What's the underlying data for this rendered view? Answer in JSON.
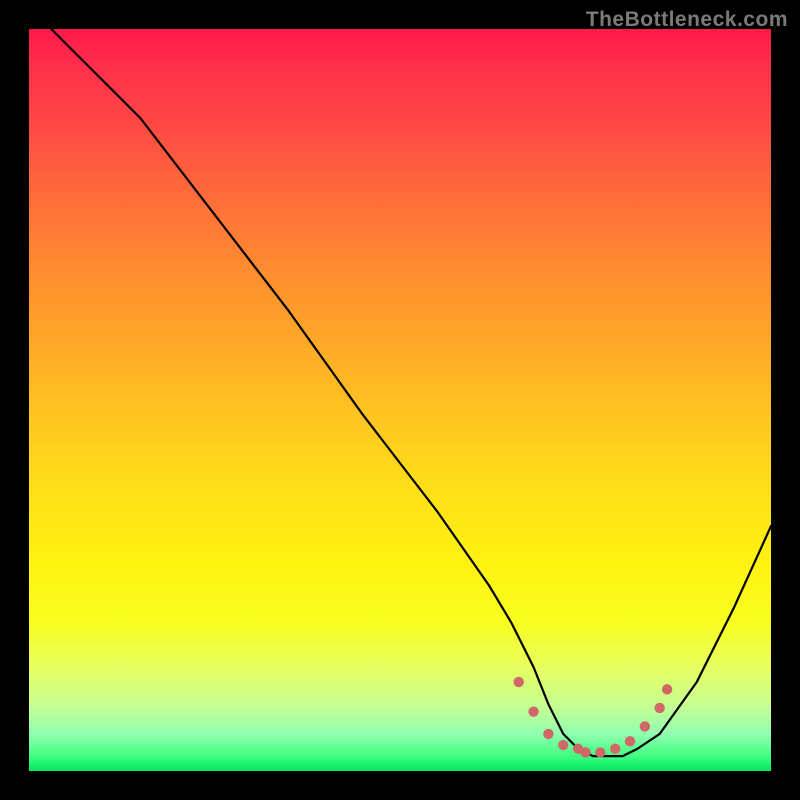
{
  "watermark": "TheBottleneck.com",
  "chart_data": {
    "type": "line",
    "title": "",
    "xlabel": "",
    "ylabel": "",
    "xlim": [
      0,
      100
    ],
    "ylim": [
      0,
      100
    ],
    "series": [
      {
        "name": "bottleneck-curve",
        "x": [
          3,
          8,
          15,
          25,
          35,
          45,
          55,
          62,
          65,
          68,
          70,
          72,
          74,
          76,
          78,
          80,
          82,
          85,
          90,
          95,
          100
        ],
        "y": [
          100,
          95,
          88,
          75,
          62,
          48,
          35,
          25,
          20,
          14,
          9,
          5,
          3,
          2,
          2,
          2,
          3,
          5,
          12,
          22,
          33
        ]
      }
    ],
    "markers": {
      "name": "optimal-range",
      "color": "#d06868",
      "points": [
        {
          "x": 66,
          "y": 12
        },
        {
          "x": 68,
          "y": 8
        },
        {
          "x": 70,
          "y": 5
        },
        {
          "x": 72,
          "y": 3.5
        },
        {
          "x": 74,
          "y": 3
        },
        {
          "x": 75,
          "y": 2.5
        },
        {
          "x": 77,
          "y": 2.5
        },
        {
          "x": 79,
          "y": 3
        },
        {
          "x": 81,
          "y": 4
        },
        {
          "x": 83,
          "y": 6
        },
        {
          "x": 85,
          "y": 8.5
        },
        {
          "x": 86,
          "y": 11
        }
      ]
    }
  }
}
